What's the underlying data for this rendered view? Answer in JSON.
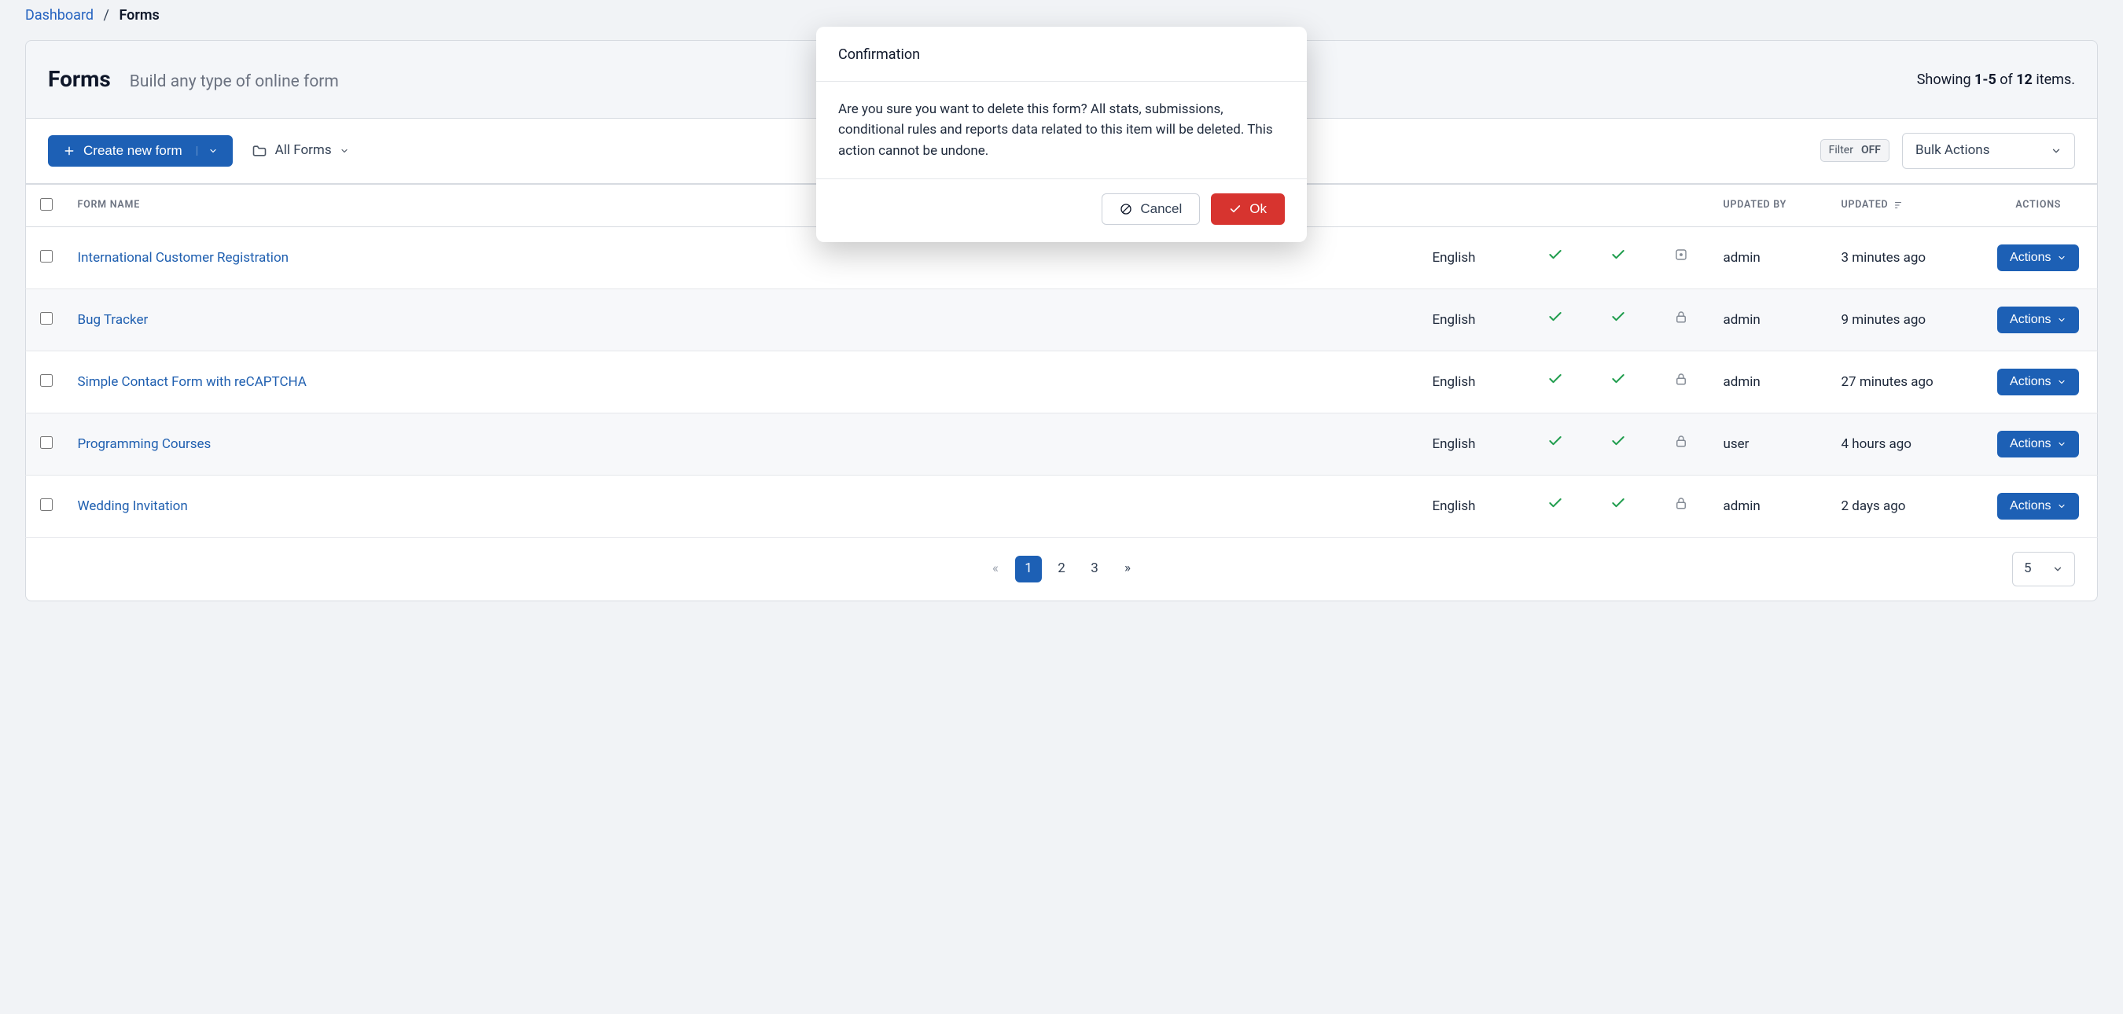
{
  "breadcrumb": {
    "root": "Dashboard",
    "current": "Forms"
  },
  "header": {
    "title": "Forms",
    "subtitle": "Build any type of online form",
    "showing_prefix": "Showing ",
    "showing_range": "1-5",
    "showing_mid": " of ",
    "showing_total": "12",
    "showing_suffix": " items."
  },
  "toolbar": {
    "create_label": "Create new form",
    "folder_label": "All Forms",
    "filter_label": "Filter",
    "filter_state": "OFF",
    "bulk_label": "Bulk Actions"
  },
  "columns": {
    "form_name": "Form Name",
    "updated_by": "Updated By",
    "updated": "Updated",
    "actions": "Actions"
  },
  "rows": [
    {
      "name": "International Customer Registration",
      "lang": "English",
      "c1": true,
      "c2": true,
      "lock": true,
      "updated_by": "admin",
      "updated": "3 minutes ago",
      "action_label": "Actions"
    },
    {
      "name": "Bug Tracker",
      "lang": "English",
      "c1": true,
      "c2": true,
      "lock": true,
      "updated_by": "admin",
      "updated": "9 minutes ago",
      "action_label": "Actions"
    },
    {
      "name": "Simple Contact Form with reCAPTCHA",
      "lang": "English",
      "c1": true,
      "c2": true,
      "lock": true,
      "updated_by": "admin",
      "updated": "27 minutes ago",
      "action_label": "Actions"
    },
    {
      "name": "Programming Courses",
      "lang": "English",
      "c1": true,
      "c2": true,
      "lock": true,
      "updated_by": "user",
      "updated": "4 hours ago",
      "action_label": "Actions"
    },
    {
      "name": "Wedding Invitation",
      "lang": "English",
      "c1": true,
      "c2": true,
      "lock": true,
      "updated_by": "admin",
      "updated": "2 days ago",
      "action_label": "Actions"
    }
  ],
  "pagination": {
    "prev": "«",
    "pages": [
      "1",
      "2",
      "3"
    ],
    "next": "»",
    "active_index": 0,
    "page_size": "5"
  },
  "modal": {
    "title": "Confirmation",
    "body": "Are you sure you want to delete this form? All stats, submissions, conditional rules and reports data related to this item will be deleted. This action cannot be undone.",
    "cancel": "Cancel",
    "ok": "Ok"
  }
}
